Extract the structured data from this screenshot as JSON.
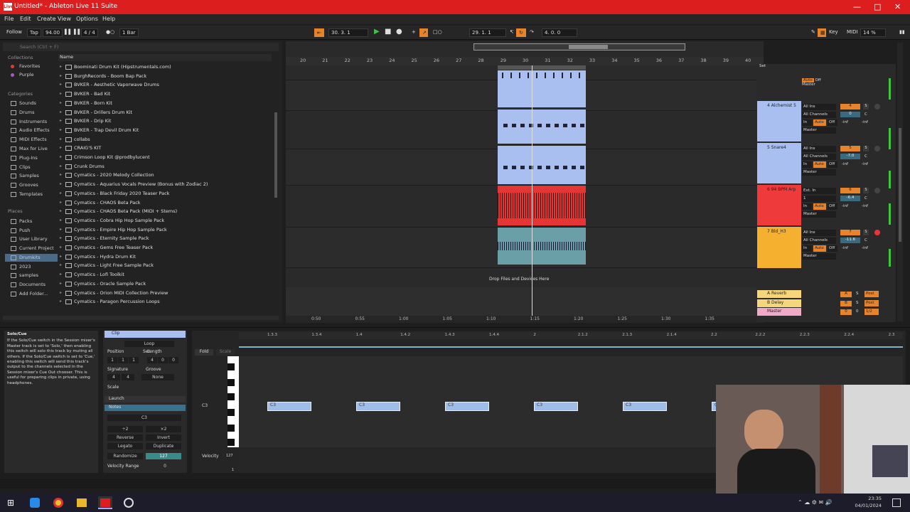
{
  "window": {
    "title": "Untitled* - Ableton Live 11 Suite",
    "logo": "Live"
  },
  "menu": [
    "File",
    "Edit",
    "Create",
    "View",
    "Options",
    "Help"
  ],
  "transport": {
    "follow": "Follow",
    "tap": "Tap",
    "tempo": "94.00",
    "signature": "4 / 4",
    "quantize": "1 Bar",
    "position": "30.  3.  1",
    "loop_start": "29.  1.  1",
    "loop_length": "4.  0.  0",
    "key": "Key",
    "midi": "MIDI",
    "cpu": "14 %"
  },
  "browser": {
    "search_placeholder": "Search (Ctrl + F)",
    "collections_header": "Collections",
    "collections": [
      "Favorites",
      "Purple"
    ],
    "categories_header": "Categories",
    "categories": [
      "Sounds",
      "Drums",
      "Instruments",
      "Audio Effects",
      "MIDI Effects",
      "Max for Live",
      "Plug-Ins",
      "Clips",
      "Samples",
      "Grooves",
      "Templates"
    ],
    "places_header": "Places",
    "places": [
      "Packs",
      "Push",
      "User Library",
      "Current Project",
      "Drumkits",
      "2023",
      "samples",
      "Documents",
      "Add Folder..."
    ],
    "name_header": "Name",
    "files": [
      "Boominati Drum Kit (Hipstrumentals.com)",
      "BurghRecords - Boom Bap Pack",
      "BVKER - Aesthetic Vaporwave Drums",
      "BVKER - Bad Kit",
      "BVKER - Born Kit",
      "BVKER - Drillers Drum Kit",
      "BVKER - Drip Kit",
      "BVKER - Trap Devil Drum Kit",
      "collabs",
      "CRAIG'S KIT",
      "Crimson Loop Kit @prodbylucent",
      "Crunk Drums",
      "Cymatics - 2020 Melody Collection",
      "Cymatics - Aquarius Vocals Preview (Bonus with Zodiac 2)",
      "Cymatics - Black Friday 2020 Teaser Pack",
      "Cymatics - CHAOS Beta Pack",
      "Cymatics - CHAOS Beta Pack (MIDI + Stems)",
      "Cymatics - Cobra Hip Hop Sample Pack",
      "Cymatics - Empire Hip Hop Sample Pack",
      "Cymatics - Eternity Sample Pack",
      "Cymatics - Gems Free Teaser Pack",
      "Cymatics - Hydra Drum Kit",
      "Cymatics - Light Free Sample Pack",
      "Cymatics - Lofi Toolkit",
      "Cymatics - Oracle Sample Pack",
      "Cymatics - Orion MIDI Collection Preview",
      "Cymatics - Paragon Percussion Loops"
    ]
  },
  "arrangement": {
    "bars": [
      "20",
      "21",
      "22",
      "23",
      "24",
      "25",
      "26",
      "27",
      "28",
      "29",
      "30",
      "31",
      "32",
      "33",
      "34",
      "35",
      "36",
      "37",
      "38",
      "39",
      "40"
    ],
    "times": [
      "0:50",
      "0:55",
      "1:00",
      "1:05",
      "1:10",
      "1:15",
      "1:20",
      "1:25",
      "1:30",
      "1:35"
    ],
    "drop_text": "Drop Files and Devices Here",
    "set_label": "Set"
  },
  "tracks": [
    {
      "name": "4 Alchemist 5",
      "input": "All Ins",
      "channel": "All Channels",
      "monitor_in": "In",
      "monitor_auto": "Auto",
      "monitor_off": "Off",
      "out": "Master",
      "vol": "4",
      "pan": "0",
      "panc": "C",
      "inf": "-inf",
      "inf2": "-inf",
      "color": "#a9bff0"
    },
    {
      "name": "5 Snare4",
      "input": "All Ins",
      "channel": "All Channels",
      "monitor_in": "In",
      "monitor_auto": "Auto",
      "monitor_off": "Off",
      "out": "Master",
      "vol": "5",
      "pan": "-7.0",
      "panc": "C",
      "inf": "-inf",
      "inf2": "-inf",
      "color": "#a9bff0"
    },
    {
      "name": "6 94 BPM Arp",
      "input": "Ext. In",
      "channel": "1",
      "monitor_in": "In",
      "monitor_auto": "Auto",
      "monitor_off": "Off",
      "out": "Master",
      "vol": "6",
      "pan": "-6.4",
      "panc": "C",
      "inf": "-inf",
      "inf2": "-inf",
      "color": "#ee3a3a"
    },
    {
      "name": "7 Bld_H3",
      "input": "All Ins",
      "channel": "All Channels",
      "monitor_in": "In",
      "monitor_auto": "Auto",
      "monitor_off": "Off",
      "out": "Master",
      "vol": "7",
      "pan": "-11.6",
      "panc": "C",
      "inf": "-inf",
      "inf2": "-inf",
      "color": "#f5b030"
    }
  ],
  "returns": [
    {
      "name": "A Reverb",
      "vol": "A",
      "s": "S",
      "post": "Post"
    },
    {
      "name": "B Delay",
      "vol": "B",
      "s": "S",
      "post": "Post"
    },
    {
      "name": "Master",
      "vol": "0",
      "s": "0",
      "post": "1/2"
    }
  ],
  "info": {
    "title": "Solo/Cue",
    "text": "If the Solo/Cue switch in the Session mixer's Master track is set to 'Solo,' then enabling this switch will solo this track by muting all others. If the Solo/Cue switch is set to 'Cue,' enabling this switch will send this track's output to the channels selected in the Session mixer's Cue Out chooser. This is useful for preparing clips in private, using headphones."
  },
  "clip": {
    "tab": "Clip",
    "loop": "Loop",
    "position_label": "Position",
    "set": "Set",
    "length_label": "Length",
    "pos_vals": [
      "1",
      "1",
      "1"
    ],
    "len_vals": [
      "4",
      "0",
      "0"
    ],
    "signature_label": "Signature",
    "groove_label": "Groove",
    "sig": [
      "4",
      "4"
    ],
    "groove": "None",
    "scale": "Scale",
    "launch": "Launch",
    "notes": "Notes",
    "note_name": "C3",
    "x2": "÷2",
    "x2b": "×2",
    "reverse": "Reverse",
    "invert": "Invert",
    "legato": "Legato",
    "duplicate": "Duplicate",
    "randomize": "Randomize",
    "rand_val": "127",
    "velocity_range": "Velocity Range",
    "vel_val": "0"
  },
  "midi": {
    "fold": "Fold",
    "scale": "Scale",
    "beats": [
      "1.3.3",
      "1.3.4",
      "1.4",
      "1.4.2",
      "1.4.3",
      "1.4.4",
      "2",
      "2.1.2",
      "2.1.3",
      "2.1.4",
      "2.2",
      "2.2.2",
      "2.2.3",
      "2.2.4",
      "2.3"
    ],
    "c3": "C3",
    "velocity": "Velocity",
    "vmax": "127",
    "vmin": "1",
    "notes": [
      "C3",
      "C3",
      "C3",
      "C3",
      "C3",
      "C3"
    ]
  },
  "taskbar": {
    "time": "23:35",
    "date": "04/01/2024"
  }
}
